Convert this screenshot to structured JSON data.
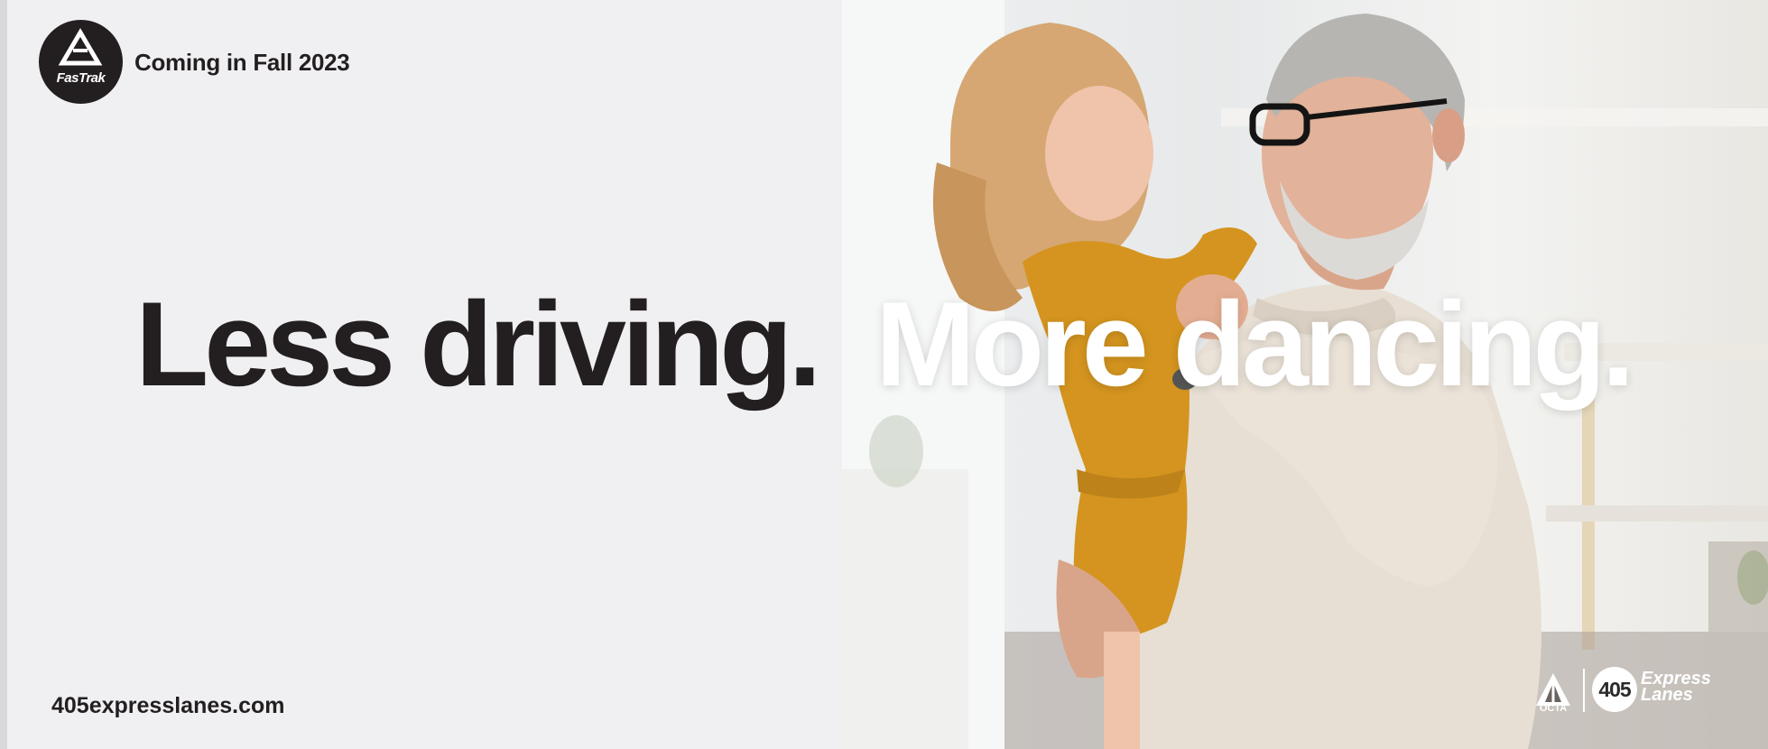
{
  "brand": {
    "logo_text": "FasTrak",
    "coming_text": "Coming in Fall 2023"
  },
  "headline": {
    "left": "Less driving.",
    "right": "More dancing."
  },
  "footer": {
    "website": "405expresslanes.com",
    "octa_label": "OCTA",
    "route_number": "405",
    "express_label_line1": "Express",
    "express_label_line2": "Lanes"
  },
  "colors": {
    "text_dark": "#231f20",
    "panel_bg": "#f0f0f2",
    "dress": "#d4941f",
    "sweater": "#e8e0d4"
  },
  "icons": {
    "fastrak_logo": "fastrak-logo-icon",
    "octa_logo": "octa-logo-icon",
    "route_shield": "route-405-shield-icon"
  }
}
